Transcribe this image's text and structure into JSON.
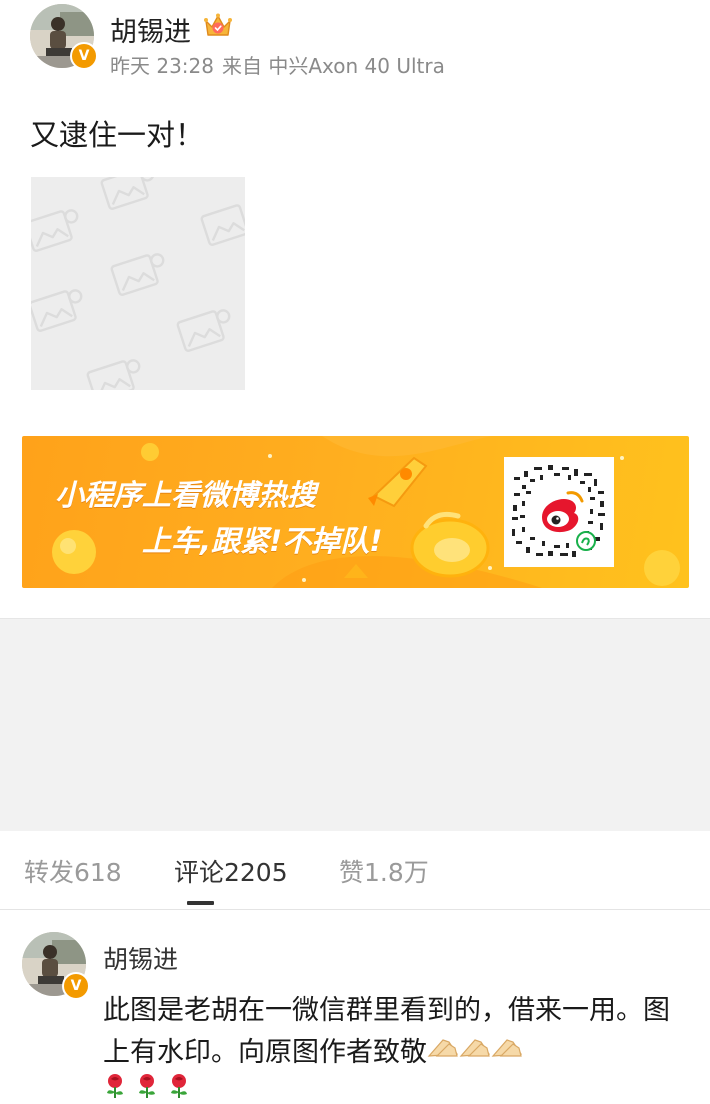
{
  "post": {
    "author": "胡锡进",
    "time": "昨天 23:28",
    "source": "来自 中兴Axon 40 Ultra",
    "text": "又逮住一对！",
    "verified_badge": "V",
    "crown_icon": "crown-icon",
    "image": "broken-image-placeholder"
  },
  "ad": {
    "line1": "小程序上看微博热搜",
    "line2": "上车,跟紧!不掉队!",
    "background_color": "#ffaa1c",
    "qr_icon": "weibo-miniprogram-qr"
  },
  "tabs": {
    "repost": "转发618",
    "comment": "评论2205",
    "like": "赞1.8万",
    "active": "comment"
  },
  "comment": {
    "author": "胡锡进",
    "text": "此图是老胡在一微信群里看到的，借来一用。图上有水印。向原图作者致敬",
    "trailing_emoji": [
      "folded-hands",
      "folded-hands",
      "folded-hands"
    ],
    "emoji_row": [
      "rose",
      "rose",
      "rose"
    ]
  },
  "colors": {
    "accent_orange": "#f39a00",
    "muted_text": "#8a8a8a"
  }
}
